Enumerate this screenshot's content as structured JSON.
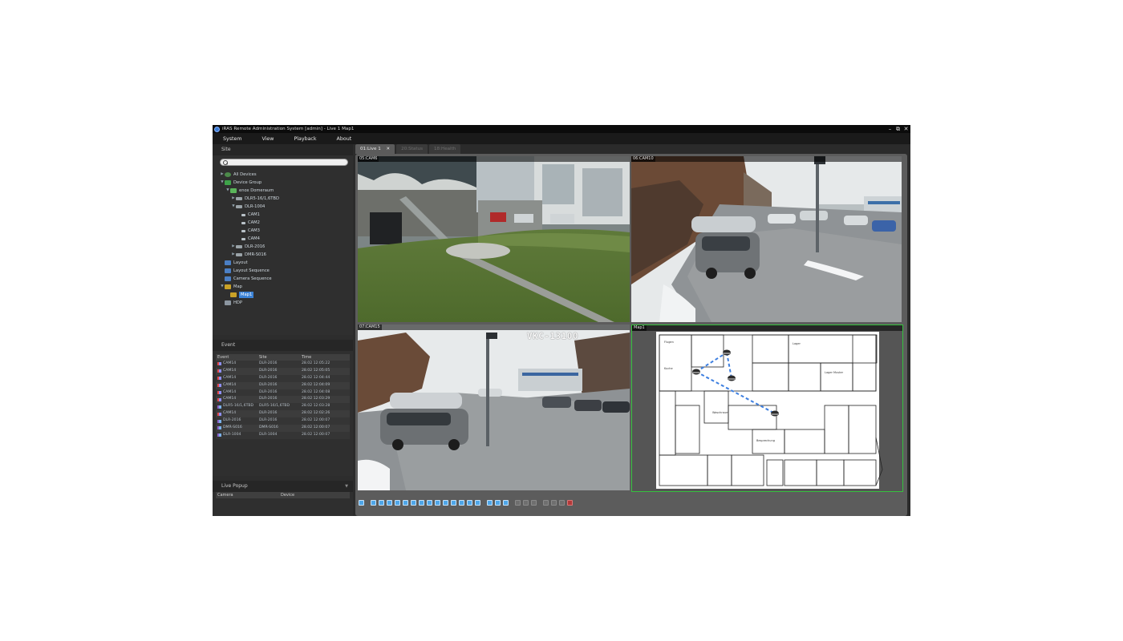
{
  "window": {
    "title": "iRAS Remote Administration System [admin] - Live 1  Map1",
    "controls": [
      "–",
      "⧉",
      "✕"
    ]
  },
  "menu": [
    "System",
    "View",
    "Playback",
    "About"
  ],
  "site_panel": {
    "title": "Site",
    "search_placeholder": "",
    "tree": [
      {
        "label": "All Devices",
        "depth": 0,
        "toggle": "▶",
        "icon": "globe-icon"
      },
      {
        "label": "Device Group",
        "depth": 0,
        "toggle": "▼",
        "icon": "device-group-icon"
      },
      {
        "label": "enox Domeraum",
        "depth": 1,
        "toggle": "▼",
        "icon": "site-icon"
      },
      {
        "label": "DLR5-16/1,6TBD",
        "depth": 2,
        "toggle": "▶",
        "icon": "dvr-icon"
      },
      {
        "label": "DLR-1004",
        "depth": 2,
        "toggle": "▼",
        "icon": "dvr-icon"
      },
      {
        "label": "CAM1",
        "depth": 3,
        "toggle": "",
        "icon": "camera-icon"
      },
      {
        "label": "CAM2",
        "depth": 3,
        "toggle": "",
        "icon": "camera-icon"
      },
      {
        "label": "CAM3",
        "depth": 3,
        "toggle": "",
        "icon": "camera-icon"
      },
      {
        "label": "CAM4",
        "depth": 3,
        "toggle": "",
        "icon": "camera-icon"
      },
      {
        "label": "DLR-2016",
        "depth": 2,
        "toggle": "▶",
        "icon": "dvr-icon"
      },
      {
        "label": "DMR-S016",
        "depth": 2,
        "toggle": "▶",
        "icon": "dvr-icon"
      },
      {
        "label": "Layout",
        "depth": 0,
        "toggle": "",
        "icon": "layout-icon"
      },
      {
        "label": "Layout Sequence",
        "depth": 0,
        "toggle": "",
        "icon": "layout-sequence-icon"
      },
      {
        "label": "Camera Sequence",
        "depth": 0,
        "toggle": "",
        "icon": "camera-sequence-icon"
      },
      {
        "label": "Map",
        "depth": 0,
        "toggle": "▼",
        "icon": "map-icon"
      },
      {
        "label": "Map1",
        "depth": 1,
        "toggle": "",
        "icon": "map-icon",
        "selected": true
      },
      {
        "label": "HDP",
        "depth": 0,
        "toggle": "",
        "icon": "hdp-icon"
      }
    ]
  },
  "event_panel": {
    "title": "Event",
    "columns": [
      "Event",
      "Site",
      "Time"
    ],
    "rows": [
      {
        "event": "CAM14",
        "site": "DLR-2016",
        "time": "28.02 12:05:22",
        "kind": "cam"
      },
      {
        "event": "CAM14",
        "site": "DLR-2016",
        "time": "28.02 12:05:05",
        "kind": "cam"
      },
      {
        "event": "CAM14",
        "site": "DLR-2016",
        "time": "28.02 12:04:44",
        "kind": "cam"
      },
      {
        "event": "CAM14",
        "site": "DLR-2016",
        "time": "28.02 12:04:09",
        "kind": "cam"
      },
      {
        "event": "CAM14",
        "site": "DLR-2016",
        "time": "28.02 12:04:08",
        "kind": "cam"
      },
      {
        "event": "CAM14",
        "site": "DLR-2016",
        "time": "28.02 12:03:29",
        "kind": "cam"
      },
      {
        "event": "DLR5-16/1,6TBD",
        "site": "DLR5-16/1,6TBD",
        "time": "28.02 12:03:28",
        "kind": "dev"
      },
      {
        "event": "CAM14",
        "site": "DLR-2016",
        "time": "28.02 12:02:26",
        "kind": "cam"
      },
      {
        "event": "DLR-2016",
        "site": "DLR-2016",
        "time": "28.02 12:00:07",
        "kind": "dev"
      },
      {
        "event": "DMR-S016",
        "site": "DMR-S016",
        "time": "28.02 12:00:07",
        "kind": "dev"
      },
      {
        "event": "DLR-1004",
        "site": "DLR-1004",
        "time": "28.02 12:00:07",
        "kind": "dev"
      }
    ]
  },
  "popup_panel": {
    "title": "Live Popup",
    "columns": [
      "Camera",
      "Device"
    ]
  },
  "tabs": [
    {
      "label": "01:Live 1",
      "active": true,
      "close": "✕"
    },
    {
      "label": "20:Status",
      "active": false
    },
    {
      "label": "18:Health",
      "active": false
    }
  ],
  "panes": {
    "p1": "05:CAM6",
    "p2": "06:CAM10",
    "p3": "07:CAM15",
    "p4": "Map1"
  },
  "overlay_text": "VKC-13100",
  "map_rooms": [
    "Flugen",
    "Kuche",
    "Lager",
    "Lager Muster",
    "Waschraum",
    "Besprechung"
  ],
  "colors": {
    "accent": "#3b82d6",
    "map_border": "#35c13e",
    "map_link": "#3d7fe0",
    "toolbar_button": "#4ea6e8"
  }
}
